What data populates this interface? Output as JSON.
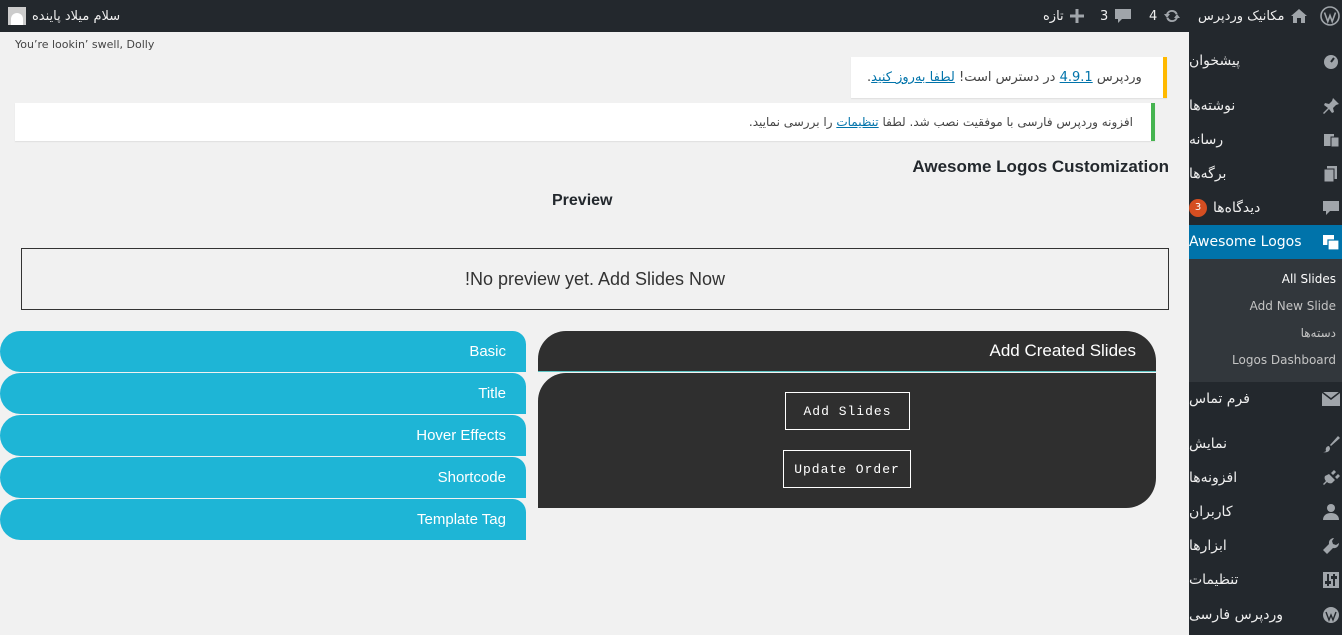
{
  "admin_bar": {
    "greeting": "سلام میلاد پاینده",
    "new_label": "تازه",
    "comments_count": "3",
    "updates_count": "4",
    "site_name": "مکانیک وردپرس"
  },
  "dolly_text": "You’re lookin’ swell, Dolly",
  "update_notice": {
    "prefix": "وردپرس",
    "version_link": "4.9.1",
    "middle": "در دسترس است!",
    "action_link": "لطفا به‌روز کنید",
    "suffix": "."
  },
  "success_notice": {
    "prefix": "افزونه وردپرس فارسی با موفقیت نصب شد. لطفا",
    "link": "تنظیمات",
    "suffix": "را بررسی نمایید."
  },
  "page_title": "Awesome Logos Customization",
  "preview_title": "Preview",
  "preview_empty": "!No preview yet. Add Slides Now",
  "tabs": [
    "Basic",
    "Title",
    "Hover Effects",
    "Shortcode",
    "Template Tag"
  ],
  "panel": {
    "title": "Add Created Slides",
    "add_button": "Add Slides",
    "update_button": "Update Order"
  },
  "sidebar": {
    "dashboard": "پیشخوان",
    "posts": "نوشته‌ها",
    "media": "رسانه",
    "pages": "برگه‌ها",
    "comments": "دیدگاه‌ها",
    "comments_badge": "3",
    "awesome_logos": "Awesome Logos",
    "contact": "فرم تماس",
    "appearance": "نمایش",
    "plugins": "افزونه‌ها",
    "users": "کاربران",
    "tools": "ابزارها",
    "settings": "تنظیمات",
    "persian": "وردپرس فارسی",
    "submenu": [
      "All Slides",
      "Add New Slide",
      "دسته‌ها",
      "Logos Dashboard"
    ]
  },
  "colors": {
    "adminbar": "#23282d",
    "active_menu": "#0073aa",
    "tab": "#1eb5d6",
    "panel": "#2f2f2f",
    "update_border": "#ffb900",
    "success_border": "#46b450",
    "badge": "#d54e21"
  }
}
